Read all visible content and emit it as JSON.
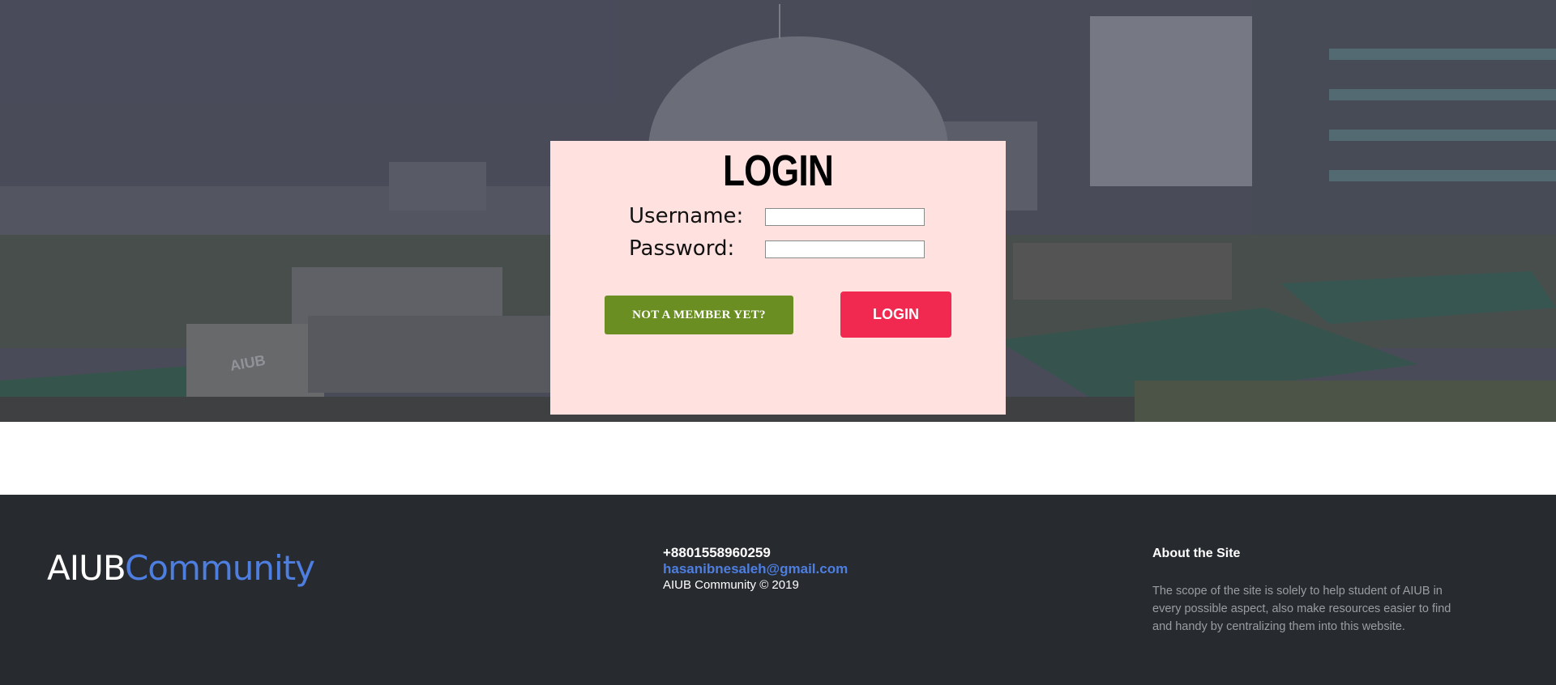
{
  "login": {
    "title": "LOGIN",
    "username_label": "Username:",
    "password_label": "Password:",
    "username_value": "",
    "password_value": "",
    "signup_button": "NOT A MEMBER YET?",
    "login_button": "LOGIN"
  },
  "footer": {
    "brand_part1": "AIUB",
    "brand_part2": "Community",
    "phone": "+8801558960259",
    "email": "hasanibnesaleh@gmail.com",
    "copyright": "AIUB Community © 2019",
    "about_title": "About the Site",
    "about_text": "The scope of the site is solely to help student of AIUB in every possible aspect, also make resources easier to find and handy by centralizing them into this website."
  },
  "hero_image": {
    "sign_text": "AIUB"
  },
  "colors": {
    "card_bg": "#ffe2e0",
    "member_button": "#6b8e23",
    "login_button": "#f1284f",
    "footer_bg": "#272b2f",
    "accent_blue": "#4d7ee0"
  }
}
